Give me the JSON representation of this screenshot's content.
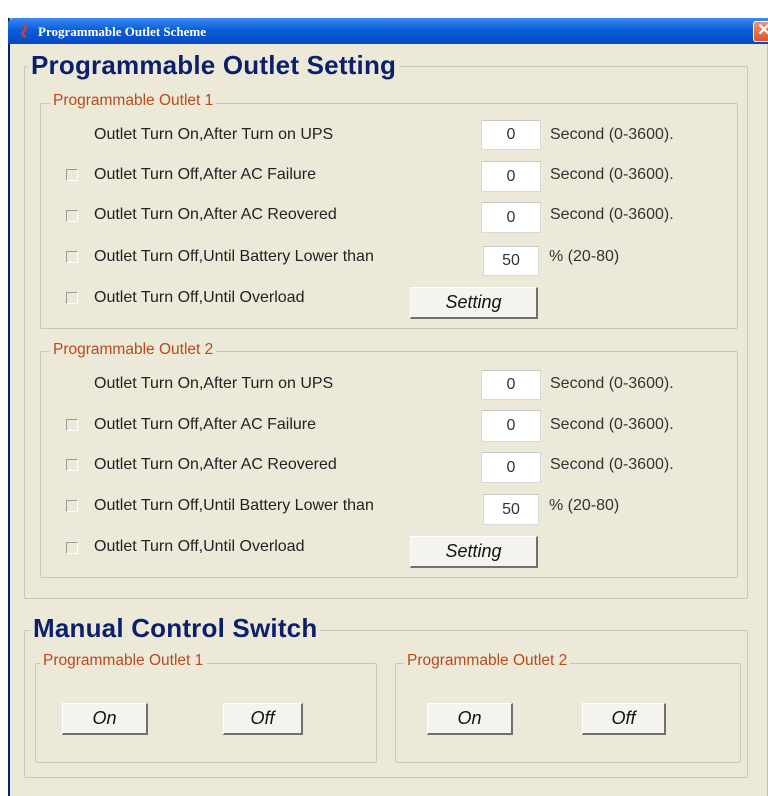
{
  "window": {
    "title": "Programmable Outlet Scheme",
    "close_symbol": "✕"
  },
  "setting_section": {
    "title": "Programmable Outlet Setting",
    "outlets": [
      {
        "title": "Programmable Outlet 1",
        "rows": [
          {
            "label": "Outlet Turn On,After Turn on UPS",
            "checkbox": false,
            "value": "0",
            "unit": "Second (0-3600)."
          },
          {
            "label": "Outlet Turn Off,After AC Failure",
            "checkbox": true,
            "checked": false,
            "value": "0",
            "unit": "Second (0-3600)."
          },
          {
            "label": "Outlet Turn On,After AC Reovered",
            "checkbox": true,
            "checked": false,
            "value": "0",
            "unit": "Second (0-3600)."
          },
          {
            "label": "Outlet Turn Off,Until Battery Lower than",
            "checkbox": true,
            "checked": false,
            "value": "50",
            "unit": "% (20-80)"
          },
          {
            "label": "Outlet Turn Off,Until Overload",
            "checkbox": true,
            "checked": false,
            "button": "Setting"
          }
        ]
      },
      {
        "title": "Programmable Outlet 2",
        "rows": [
          {
            "label": "Outlet Turn On,After Turn on UPS",
            "checkbox": false,
            "value": "0",
            "unit": "Second (0-3600)."
          },
          {
            "label": "Outlet Turn Off,After AC Failure",
            "checkbox": true,
            "checked": false,
            "value": "0",
            "unit": "Second (0-3600)."
          },
          {
            "label": "Outlet Turn On,After AC Reovered",
            "checkbox": true,
            "checked": false,
            "value": "0",
            "unit": "Second (0-3600)."
          },
          {
            "label": "Outlet Turn Off,Until Battery Lower than",
            "checkbox": true,
            "checked": false,
            "value": "50",
            "unit": "% (20-80)"
          },
          {
            "label": "Outlet Turn Off,Until Overload",
            "checkbox": true,
            "checked": false,
            "button": "Setting"
          }
        ]
      }
    ]
  },
  "manual_section": {
    "title": "Manual Control Switch",
    "outlets": [
      {
        "title": "Programmable Outlet 1",
        "on_label": "On",
        "off_label": "Off"
      },
      {
        "title": "Programmable Outlet 2",
        "on_label": "On",
        "off_label": "Off"
      }
    ]
  },
  "colors": {
    "titlebar": "#0a5fd8",
    "section_title": "#0b1f6b",
    "group_title": "#b84a1c",
    "background": "#ece9d8"
  }
}
